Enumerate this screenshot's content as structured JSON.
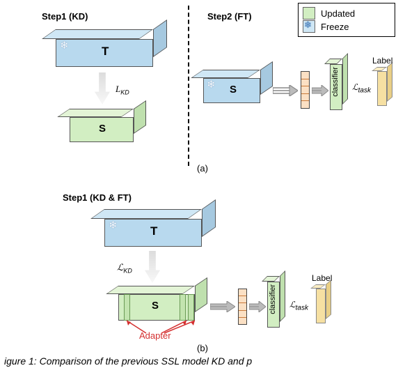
{
  "legend": {
    "updated": "Updated",
    "freeze": "Freeze"
  },
  "panelA": {
    "step1": "Step1 (KD)",
    "step2": "Step2 (FT)",
    "teacher": "T",
    "student": "S",
    "kd": "L",
    "kd_sub": "KD",
    "student2": "S",
    "classifier": "classifier",
    "loss": "L",
    "loss_sub": "task",
    "label": "Label",
    "sub": "(a)"
  },
  "panelB": {
    "step": "Step1 (KD & FT)",
    "teacher": "T",
    "kd": "L",
    "kd_sub": "KD",
    "student": "S",
    "adapter": "Adapter",
    "classifier": "classifier",
    "loss": "L",
    "loss_sub": "task",
    "label": "Label",
    "sub": "(b)"
  },
  "caption": "igure 1: Comparison of the previous SSL model KD and p"
}
